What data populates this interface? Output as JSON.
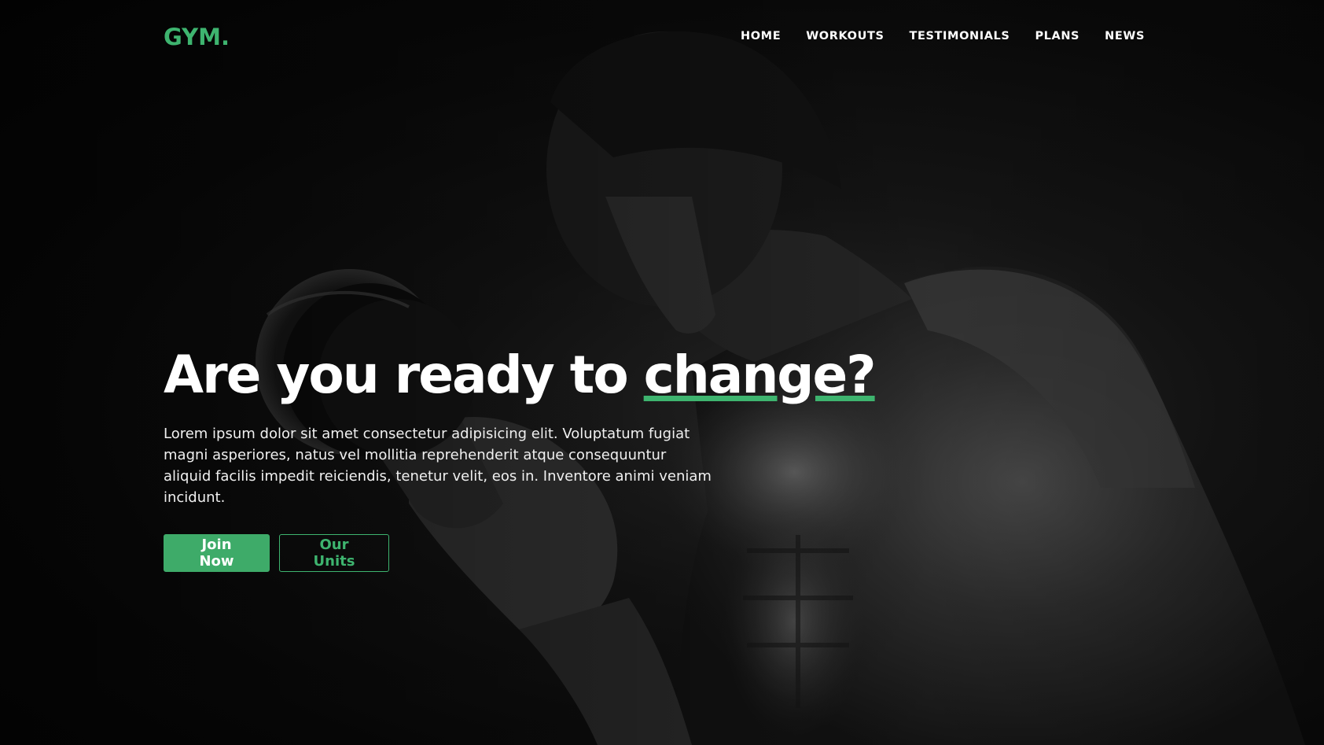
{
  "brand": {
    "logo_text": "GYM.",
    "accent_color": "#3eb46f"
  },
  "nav": {
    "items": [
      {
        "label": "HOME"
      },
      {
        "label": "WORKOUTS"
      },
      {
        "label": "TESTIMONIALS"
      },
      {
        "label": "PLANS"
      },
      {
        "label": "NEWS"
      }
    ]
  },
  "hero": {
    "headline_prefix": "Are you ready to ",
    "headline_accent": "change?",
    "description": "Lorem ipsum dolor sit amet consectetur adipisicing elit. Voluptatum fugiat magni asperiores, natus vel mollitia reprehenderit atque consequuntur aliquid facilis impedit reiciendis, tenetur velit, eos in. Inventore animi veniam incidunt.",
    "primary_button": "Join Now",
    "secondary_button": "Our Units",
    "background_image": "athlete-with-dumbbell-photo"
  },
  "colors": {
    "accent": "#3eb46f",
    "button_primary": "#3eab69",
    "background": "#0b0b0b"
  }
}
